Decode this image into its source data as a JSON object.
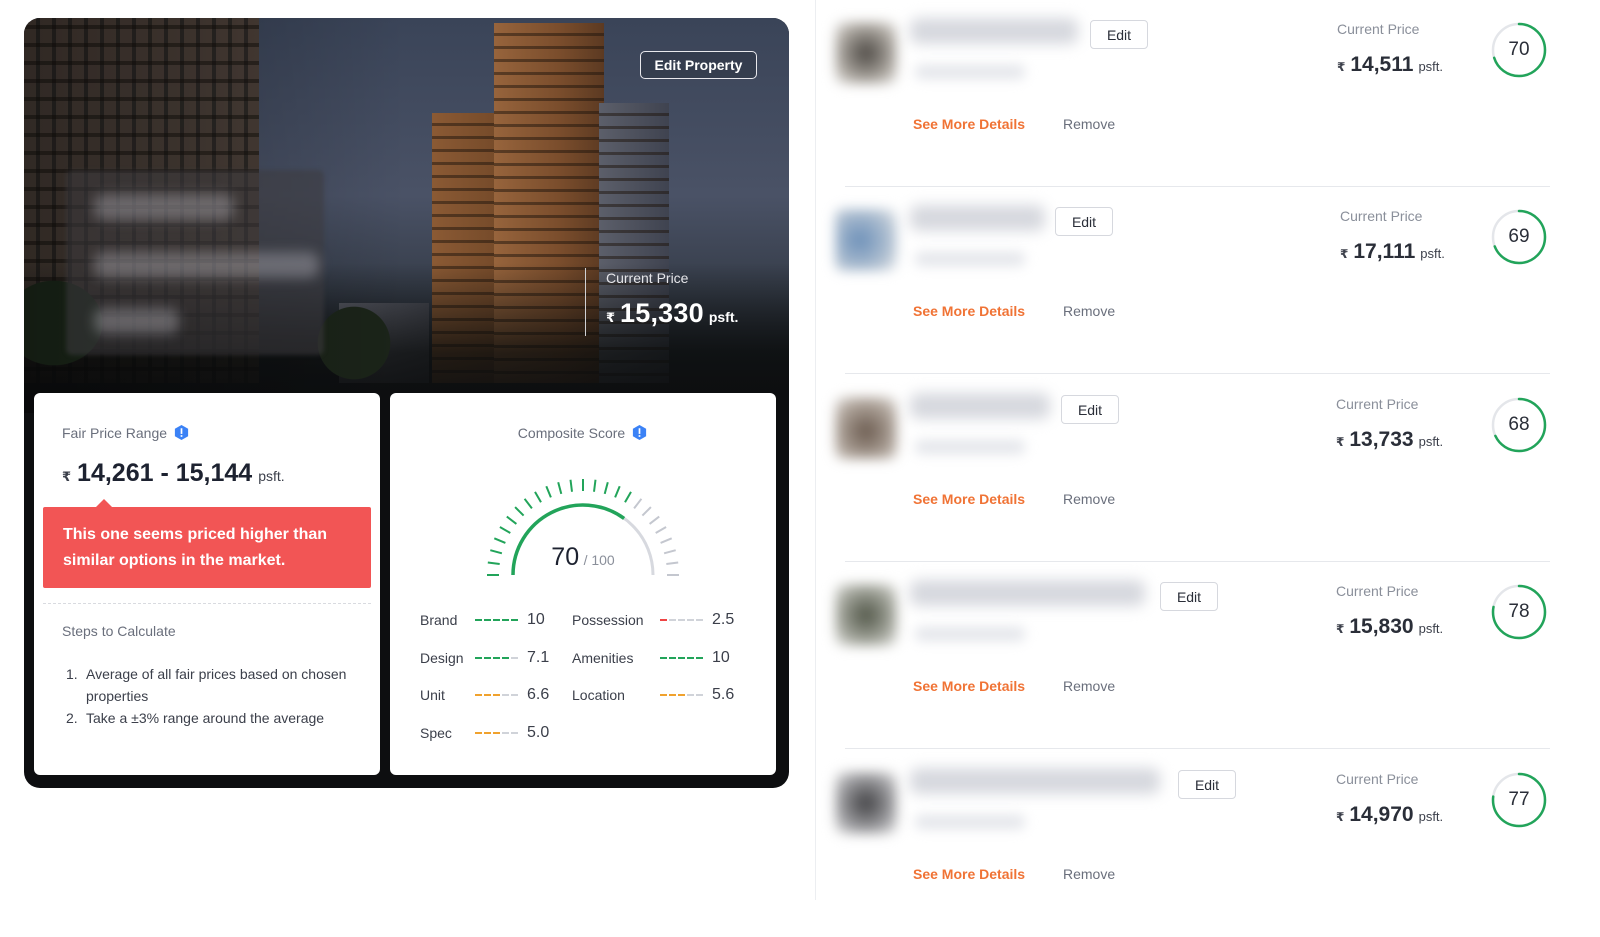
{
  "hero": {
    "edit_button": "Edit Property",
    "current_price_label": "Current Price",
    "currency": "₹",
    "price": "15,330",
    "unit": "psft."
  },
  "fair_price": {
    "title": "Fair Price Range",
    "currency": "₹",
    "range": "14,261 - 15,144",
    "unit": "psft.",
    "warning": "This one seems priced higher than similar options in the market.",
    "steps_title": "Steps to Calculate",
    "steps": [
      {
        "num": "1.",
        "text": "Average of all fair prices based on chosen properties"
      },
      {
        "num": "2.",
        "text": "Take a ±3% range around the average"
      }
    ]
  },
  "composite": {
    "title": "Composite Score",
    "score": "70",
    "max": "/ 100",
    "score_fraction": 0.7,
    "metrics_left": [
      {
        "label": "Brand",
        "value": "10",
        "level": 1.0,
        "color": "#22a45a"
      },
      {
        "label": "Design",
        "value": "7.1",
        "level": 0.71,
        "color": "#22a45a"
      },
      {
        "label": "Unit",
        "value": "6.6",
        "level": 0.6,
        "color": "#f0a22e"
      },
      {
        "label": "Spec",
        "value": "5.0",
        "level": 0.5,
        "color": "#f0a22e"
      }
    ],
    "metrics_right": [
      {
        "label": "Possession",
        "value": "2.5",
        "level": 0.25,
        "color": "#ef4444"
      },
      {
        "label": "Amenities",
        "value": "10",
        "level": 1.0,
        "color": "#22a45a"
      },
      {
        "label": "Location",
        "value": "5.6",
        "level": 0.6,
        "color": "#f0a22e"
      }
    ]
  },
  "properties": [
    {
      "edit": "Edit",
      "see_more": "See More Details",
      "remove": "Remove",
      "price_label": "Current Price",
      "currency": "₹",
      "price": "14,511",
      "unit": "psft.",
      "score": "70",
      "score_fraction": 0.7
    },
    {
      "edit": "Edit",
      "see_more": "See More Details",
      "remove": "Remove",
      "price_label": "Current Price",
      "currency": "₹",
      "price": "17,111",
      "unit": "psft.",
      "score": "69",
      "score_fraction": 0.69
    },
    {
      "edit": "Edit",
      "see_more": "See More Details",
      "remove": "Remove",
      "price_label": "Current Price",
      "currency": "₹",
      "price": "13,733",
      "unit": "psft.",
      "score": "68",
      "score_fraction": 0.68
    },
    {
      "edit": "Edit",
      "see_more": "See More Details",
      "remove": "Remove",
      "price_label": "Current Price",
      "currency": "₹",
      "price": "15,830",
      "unit": "psft.",
      "score": "78",
      "score_fraction": 0.78
    },
    {
      "edit": "Edit",
      "see_more": "See More Details",
      "remove": "Remove",
      "price_label": "Current Price",
      "currency": "₹",
      "price": "14,970",
      "unit": "psft.",
      "score": "77",
      "score_fraction": 0.77
    }
  ],
  "colors": {
    "accent_orange": "#f07335",
    "warning_red": "#f25555",
    "score_green": "#22a45a",
    "info_blue": "#3b82f6"
  },
  "icons": [
    "info-icon"
  ]
}
